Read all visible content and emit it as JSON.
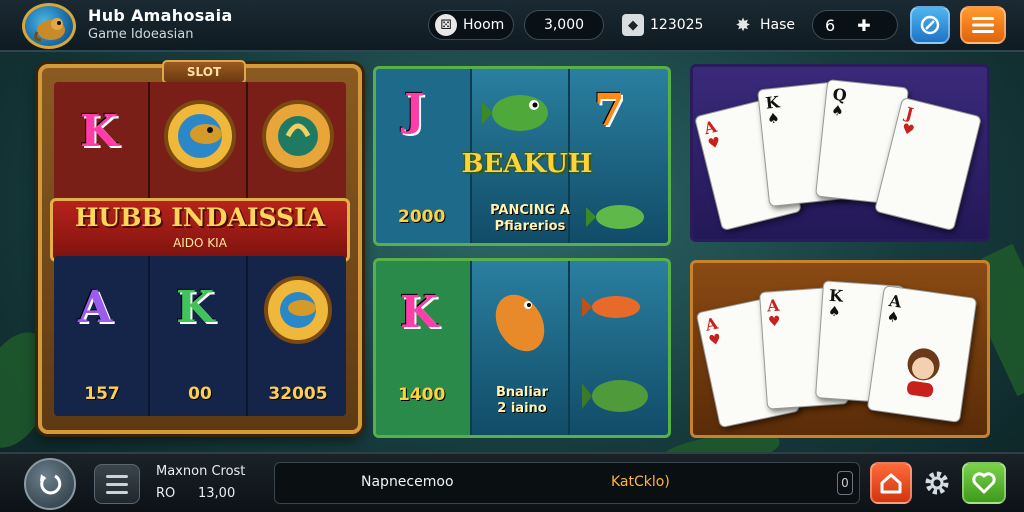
{
  "header": {
    "title": "Hub Amahosaia",
    "subtitle": "Game Idoeasian",
    "room_label": "Hoom",
    "coins": "3,000",
    "chips": "123025",
    "gems_label": "Hase",
    "level": "6"
  },
  "slot": {
    "tag": "SLOT",
    "banner_title": "HUBB INDAISSIA",
    "banner_sub": "AIDO KIA",
    "top_symbols": [
      "K",
      "",
      ""
    ],
    "bottom_symbols": [
      "A",
      "K",
      ""
    ],
    "values": [
      "157",
      "00",
      "32005"
    ]
  },
  "fishing_top": {
    "symbols": [
      "J",
      "",
      "7"
    ],
    "title": "BEAKUH",
    "sub1": "PANCING A",
    "sub2": "Pfiarerios",
    "value": "2000"
  },
  "fishing_bottom": {
    "symbol": "K",
    "value": "1400",
    "sub1": "Bnaliar",
    "sub2": "2 iaino"
  },
  "cards_top": [
    {
      "rank": "A",
      "suit": "♥",
      "color": "red"
    },
    {
      "rank": "K",
      "suit": "♠",
      "color": "blk"
    },
    {
      "rank": "Q",
      "suit": "♠",
      "color": "blk"
    },
    {
      "rank": "J",
      "suit": "♥",
      "color": "red"
    }
  ],
  "cards_bottom": [
    {
      "rank": "A",
      "suit": "♥",
      "color": "red"
    },
    {
      "rank": "A",
      "suit": "♥",
      "color": "red"
    },
    {
      "rank": "K",
      "suit": "♠",
      "color": "blk"
    },
    {
      "rank": "A",
      "suit": "♠",
      "color": "blk"
    }
  ],
  "footer": {
    "mode_line1": "Maxnon Crost",
    "mode_a": "RO",
    "mode_b": "13,00",
    "info_left": "Napnecemoo",
    "info_right": "KatCklo)",
    "info_count": "0"
  },
  "colors": {
    "accent_gold": "#ffd23a",
    "button_blue": "#1e74c6",
    "button_orange": "#e2620c",
    "button_green": "#3f9a1c",
    "button_red": "#d1350f"
  }
}
